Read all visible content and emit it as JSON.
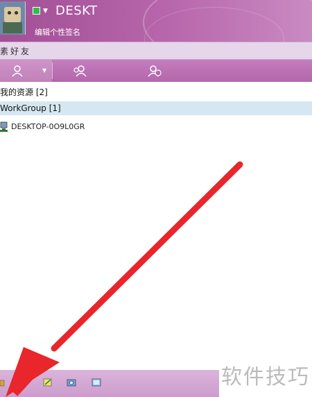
{
  "header": {
    "nickname": "DESKT",
    "signature": "编辑个性签名"
  },
  "search": {
    "text": "素好友"
  },
  "tabs": [
    {
      "icon": "contacts-icon"
    },
    {
      "icon": "groups-icon"
    },
    {
      "icon": "recent-icon"
    }
  ],
  "groups": {
    "mine": "我的资源 [2]",
    "workgroup": "WorkGroup [1]"
  },
  "contact": {
    "name": "DESKTOP-0O9L0GR"
  },
  "watermark": "软件技巧",
  "colors": {
    "theme": "#b867ac",
    "group_highlight": "#d5e8f2",
    "arrow": "#e8262b"
  }
}
